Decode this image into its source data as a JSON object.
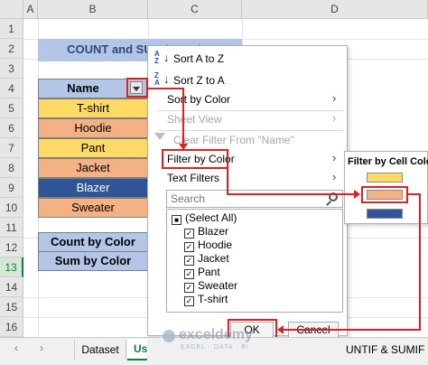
{
  "sheet": {
    "columns": [
      "A",
      "B",
      "C",
      "D"
    ],
    "rows": [
      "1",
      "2",
      "3",
      "4",
      "5",
      "6",
      "7",
      "8",
      "9",
      "10",
      "11",
      "12",
      "13",
      "14",
      "15",
      "16"
    ],
    "title_partial": "COUNT and SUM by Color",
    "header_label": "Name",
    "items": [
      {
        "label": "T-shirt",
        "color": "#ffd966"
      },
      {
        "label": "Hoodie",
        "color": "#f4b183"
      },
      {
        "label": "Pant",
        "color": "#ffd966"
      },
      {
        "label": "Jacket",
        "color": "#f4b183"
      },
      {
        "label": "Blazer",
        "color": "#2f5597"
      },
      {
        "label": "Sweater",
        "color": "#f4b183"
      }
    ],
    "count_label": "Count by Color",
    "sum_label": "Sum by Color"
  },
  "menu": {
    "sort_az": "Sort A to Z",
    "sort_za": "Sort Z to A",
    "sort_by_color": "Sort by Color",
    "sheet_view": "Sheet View",
    "clear_filter": "Clear Filter From \"Name\"",
    "filter_by_color": "Filter by Color",
    "text_filters": "Text Filters",
    "search_placeholder": "Search",
    "checkbox_items": [
      "(Select All)",
      "Blazer",
      "Hoodie",
      "Jacket",
      "Pant",
      "Sweater",
      "T-shirt"
    ],
    "ok_label": "OK",
    "cancel_label": "Cancel"
  },
  "submenu": {
    "title": "Filter by Cell Color",
    "swatches": [
      "#ffd966",
      "#f4b183",
      "#2f5597"
    ]
  },
  "tabs": {
    "sheet1": "Dataset",
    "sheet2_partial": "Us",
    "sheet3_partial": "UNTIF & SUMIF Func"
  },
  "watermark": {
    "brand": "exceldemy",
    "tagline": "EXCEL · DATA · BI"
  },
  "colors": {
    "annotation_red": "#e02020",
    "header_blue": "#b4c6e7",
    "excel_green": "#107c41"
  }
}
